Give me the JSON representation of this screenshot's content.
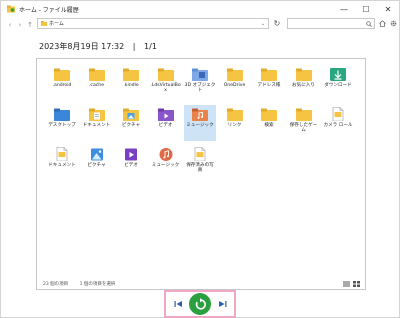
{
  "window": {
    "title": "ホーム - ファイル履歴",
    "minimize": "—",
    "maximize": "☐",
    "close": "✕"
  },
  "nav": {
    "back": "‹",
    "forward": "›",
    "up": "↑"
  },
  "address": {
    "path": "ホーム"
  },
  "heading": {
    "datetime": "2023年8月19日 17:32",
    "separator": "|",
    "page": "1/1"
  },
  "items": [
    {
      "label": ".android",
      "type": "folder"
    },
    {
      "label": ".cache",
      "type": "folder"
    },
    {
      "label": ".kindle",
      "type": "folder"
    },
    {
      "label": ".LdsVirtualBox",
      "type": "folder"
    },
    {
      "label": "3D オブジェクト",
      "type": "folder-3d"
    },
    {
      "label": "OneDrive",
      "type": "folder"
    },
    {
      "label": "アドレス帳",
      "type": "folder"
    },
    {
      "label": "お気に入り",
      "type": "folder"
    },
    {
      "label": "ダウンロード",
      "type": "folder-download"
    },
    {
      "label": "デスクトップ",
      "type": "folder-blue"
    },
    {
      "label": "ドキュメント",
      "type": "folder-doc"
    },
    {
      "label": "ピクチャ",
      "type": "folder-pic"
    },
    {
      "label": "ビデオ",
      "type": "folder-video"
    },
    {
      "label": "ミュージック",
      "type": "folder-music"
    },
    {
      "label": "リンク",
      "type": "folder"
    },
    {
      "label": "検索",
      "type": "folder"
    },
    {
      "label": "保存したゲーム",
      "type": "folder"
    },
    {
      "label": "カメラ ロール",
      "type": "doc"
    },
    {
      "label": "ドキュメント",
      "type": "doc"
    },
    {
      "label": "ピクチャ",
      "type": "pic"
    },
    {
      "label": "ビデオ",
      "type": "video"
    },
    {
      "label": "ミュージック",
      "type": "music"
    },
    {
      "label": "保存済みの写真",
      "type": "doc"
    }
  ],
  "status": {
    "count": "23 個の項目",
    "selected": "1 個の項目を選択"
  },
  "colors": {
    "folder": "#f5c443",
    "accent": "#2aa040",
    "highlight": "#f0a7c4"
  }
}
